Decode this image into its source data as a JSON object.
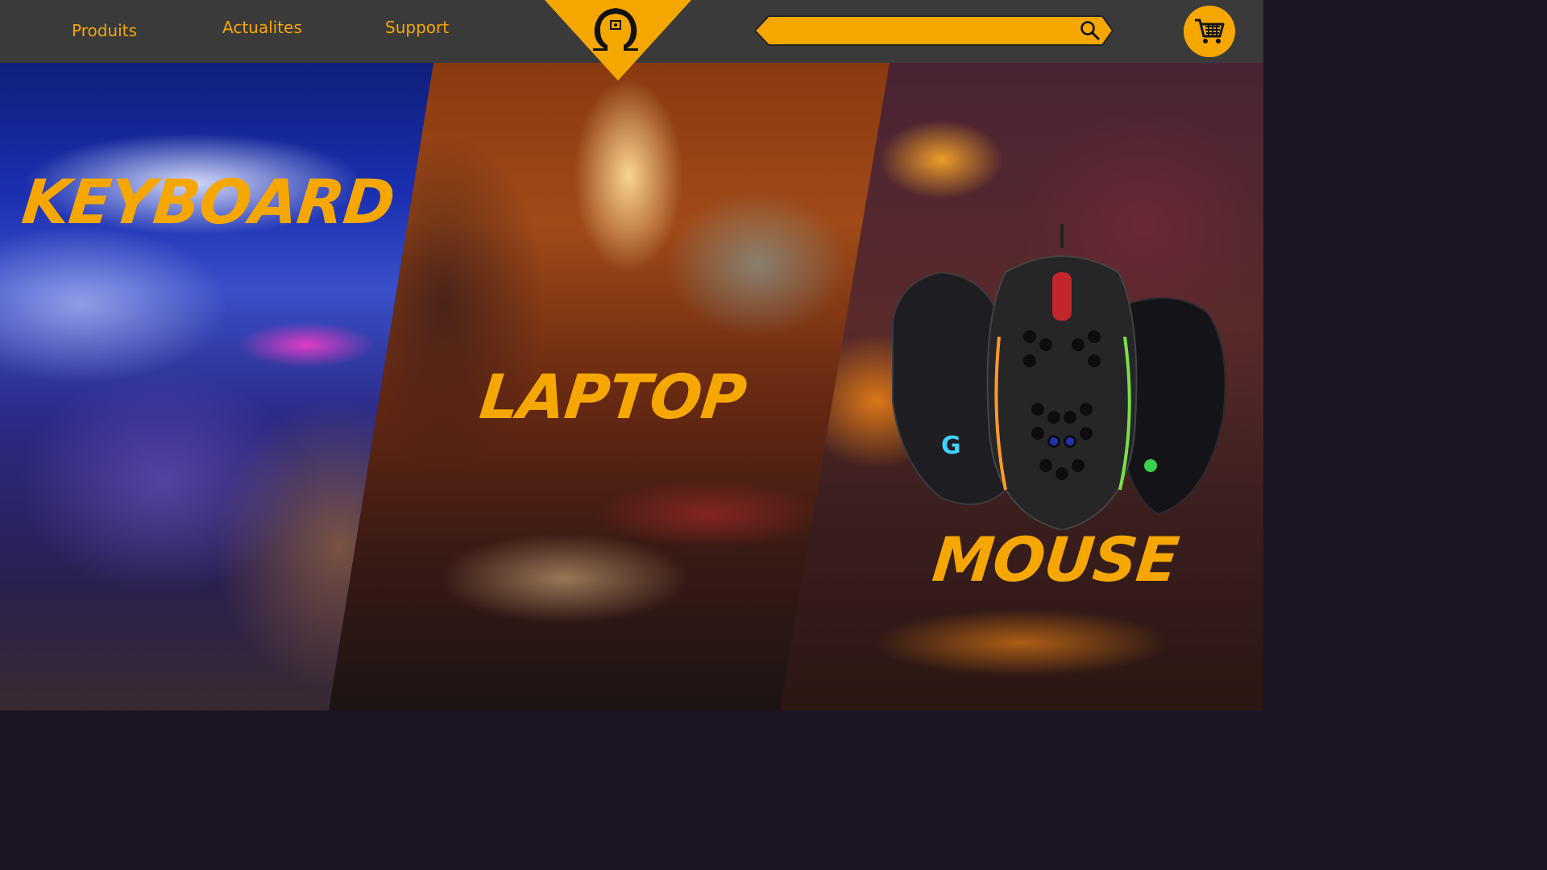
{
  "nav": {
    "links": [
      {
        "label": "Produits"
      },
      {
        "label": "Actualites"
      },
      {
        "label": "Support"
      }
    ]
  },
  "logo": {
    "icon": "omega-logo-icon"
  },
  "search": {
    "placeholder": "",
    "value": "",
    "icon": "search-icon"
  },
  "cart": {
    "icon": "cart-icon"
  },
  "panels": [
    {
      "title": "KEYBOARD"
    },
    {
      "title": "LAPTOP"
    },
    {
      "title": "MOUSE"
    }
  ],
  "colors": {
    "accent": "#f5a700",
    "header_bg": "#3a3a3a",
    "text_dark": "#111111"
  }
}
